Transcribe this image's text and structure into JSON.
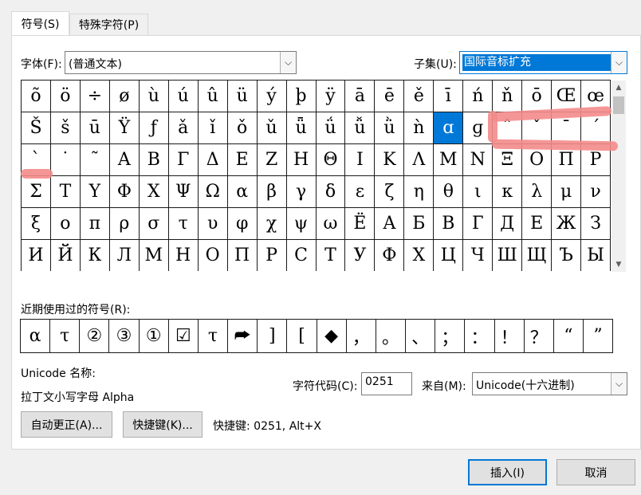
{
  "tabs": [
    {
      "label": "符号(S)"
    },
    {
      "label": "特殊字符(P)"
    }
  ],
  "font": {
    "label": "字体(F):",
    "value": "(普通文本)"
  },
  "subset": {
    "label": "子集(U):",
    "value": "国际音标扩充"
  },
  "grid": {
    "rows": [
      [
        "õ",
        "ö",
        "÷",
        "ø",
        "ù",
        "ú",
        "û",
        "ü",
        "ý",
        "þ",
        "ÿ",
        "ā",
        "ē",
        "ě",
        "ī",
        "ń",
        "ň",
        "ō",
        "Œ",
        "œ"
      ],
      [
        "Š",
        "š",
        "ū",
        "Ÿ",
        "ƒ",
        "ǎ",
        "ǐ",
        "ǒ",
        "ǔ",
        "ǖ",
        "ǘ",
        "ǚ",
        "ǜ",
        "ǹ",
        "ɑ",
        "ɡ",
        "ˆ",
        "ˇ",
        "ˉ",
        "ˊ"
      ],
      [
        "ˋ",
        "˙",
        "˜",
        "Α",
        "Β",
        "Γ",
        "Δ",
        "Ε",
        "Ζ",
        "Η",
        "Θ",
        "Ι",
        "Κ",
        "Λ",
        "Μ",
        "Ν",
        "Ξ",
        "Ο",
        "Π",
        "Ρ"
      ],
      [
        "Σ",
        "Τ",
        "Υ",
        "Φ",
        "Χ",
        "Ψ",
        "Ω",
        "α",
        "β",
        "γ",
        "δ",
        "ε",
        "ζ",
        "η",
        "θ",
        "ι",
        "κ",
        "λ",
        "μ",
        "ν"
      ],
      [
        "ξ",
        "ο",
        "π",
        "ρ",
        "σ",
        "τ",
        "υ",
        "φ",
        "χ",
        "ψ",
        "ω",
        "Ё",
        "А",
        "Б",
        "В",
        "Г",
        "Д",
        "Е",
        "Ж",
        "З"
      ],
      [
        "И",
        "Й",
        "К",
        "Л",
        "М",
        "Н",
        "О",
        "П",
        "Р",
        "С",
        "Т",
        "У",
        "Ф",
        "Х",
        "Ц",
        "Ч",
        "Ш",
        "Щ",
        "Ъ",
        "Ы"
      ]
    ],
    "selected_row": 1,
    "selected_col": 14
  },
  "recent": {
    "label": "近期使用过的符号(R):",
    "symbols": [
      "α",
      "τ",
      "②",
      "③",
      "①",
      "☑",
      "τ",
      "⮫",
      "]",
      "[",
      "◆",
      "，",
      "。",
      "、",
      "；",
      "：",
      "！",
      "？",
      "“",
      "”"
    ]
  },
  "unicode_name": {
    "label": "Unicode 名称:",
    "value": "拉丁文小写字母 Alpha"
  },
  "char_code": {
    "label": "字符代码(C):",
    "value": "0251"
  },
  "from": {
    "label": "来自(M):",
    "value": "Unicode(十六进制)"
  },
  "buttons": {
    "autocorrect": "自动更正(A)...",
    "shortcut_key": "快捷键(K)...",
    "shortcut_info": "快捷键: 0251, Alt+X",
    "insert": "插入(I)",
    "cancel": "取消"
  },
  "colors": {
    "accent": "#0078d7",
    "annotation": "#f48b8b"
  }
}
